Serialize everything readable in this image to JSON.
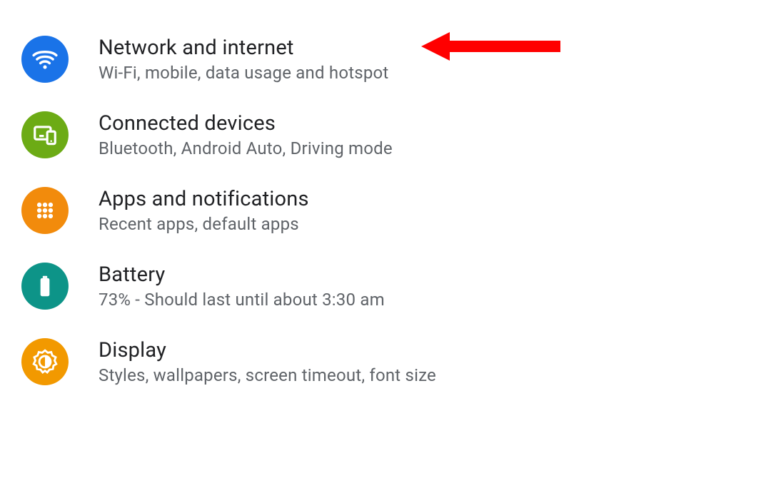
{
  "settings": {
    "items": [
      {
        "title": "Network and internet",
        "subtitle": "Wi-Fi, mobile, data usage and hotspot",
        "icon": "wifi-icon",
        "color": "#1a73e8"
      },
      {
        "title": "Connected devices",
        "subtitle": "Bluetooth, Android Auto, Driving mode",
        "icon": "devices-icon",
        "color": "#6cab15"
      },
      {
        "title": "Apps and notifications",
        "subtitle": "Recent apps, default apps",
        "icon": "apps-icon",
        "color": "#f28b0c"
      },
      {
        "title": "Battery",
        "subtitle": "73% - Should last until about 3:30 am",
        "icon": "battery-icon",
        "color": "#0d9488"
      },
      {
        "title": "Display",
        "subtitle": "Styles, wallpapers, screen timeout, font size",
        "icon": "display-icon",
        "color": "#f29900"
      }
    ]
  },
  "annotation": {
    "arrow_color": "#ff0000",
    "points_to": "network-and-internet"
  }
}
